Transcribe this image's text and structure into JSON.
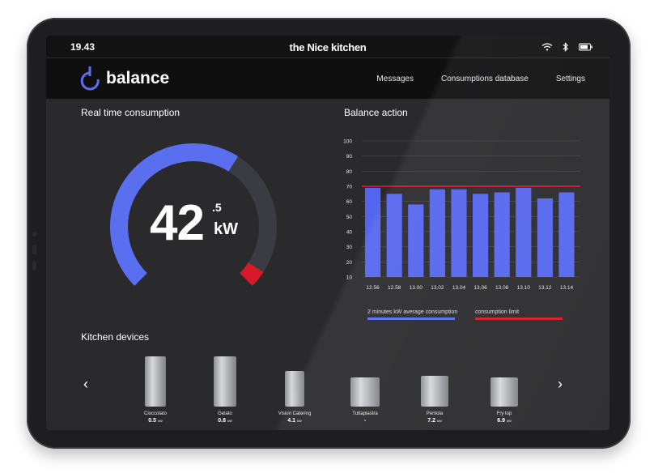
{
  "status": {
    "time": "19.43",
    "brand": "the Nice kitchen"
  },
  "nav": {
    "logo": "balance",
    "items": [
      "Messages",
      "Consumptions database",
      "Settings"
    ]
  },
  "realtime": {
    "title": "Real time consumption",
    "value_int": "42",
    "value_dec": ".5",
    "unit": "kW",
    "fill_fraction": 0.62
  },
  "balance": {
    "title": "Balance action",
    "legend": {
      "average": "2 minutes kW average consumption",
      "limit": "consumption limit"
    }
  },
  "chart_data": {
    "type": "bar",
    "categories": [
      "12.56",
      "12.58",
      "13.00",
      "13.02",
      "13.04",
      "13.06",
      "13.08",
      "13.10",
      "13.12",
      "13.14"
    ],
    "series": [
      {
        "name": "2 minutes kW average consumption",
        "values": [
          69,
          65,
          58,
          68,
          68,
          65,
          66,
          69,
          62,
          66
        ]
      }
    ],
    "limit": {
      "name": "consumption limit",
      "value": 70
    },
    "yticks": [
      100,
      90,
      80,
      70,
      60,
      50,
      40,
      30,
      20,
      10
    ],
    "ylim": [
      10,
      100
    ],
    "grid": true,
    "legend_position": "bottom",
    "colors": {
      "bar": "#5566ee",
      "limit": "#e41b2a"
    }
  },
  "devices": {
    "title": "Kitchen devices",
    "items": [
      {
        "name": "Cioccolato",
        "value": "0.5",
        "unit": "kW"
      },
      {
        "name": "Gelato",
        "value": "0.8",
        "unit": "kW"
      },
      {
        "name": "Vision Catering",
        "value": "4.1",
        "unit": "kW"
      },
      {
        "name": "Tuttapiastra",
        "value": "-",
        "unit": ""
      },
      {
        "name": "Pentola",
        "value": "7.2",
        "unit": "kW"
      },
      {
        "name": "Fry top",
        "value": "6.9",
        "unit": "kW"
      }
    ]
  },
  "colors": {
    "accent": "#5a6ef0",
    "limit": "#d7192a",
    "background": "#2a2a2c"
  }
}
